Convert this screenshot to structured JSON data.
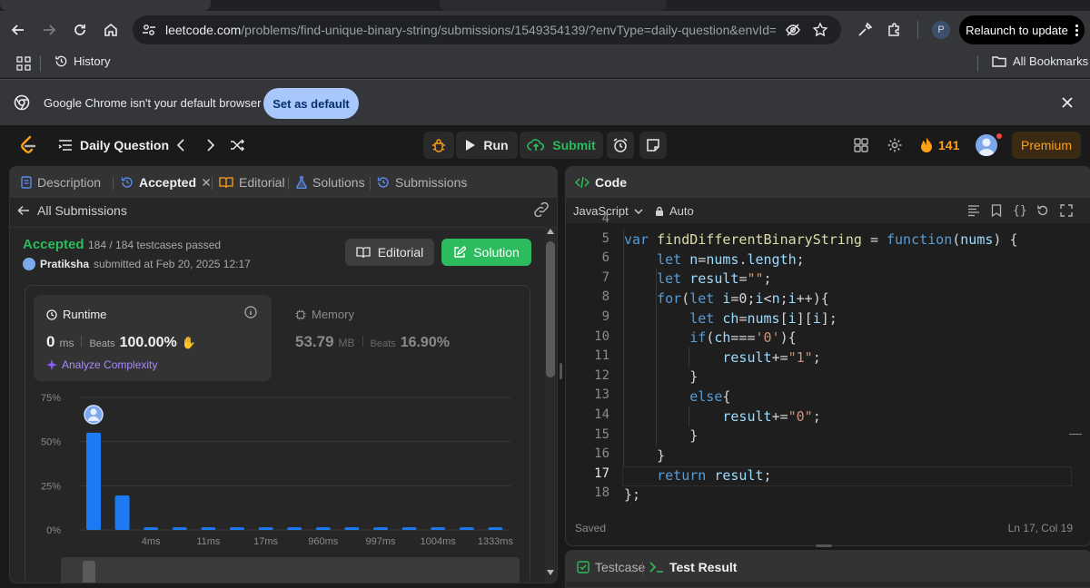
{
  "browser": {
    "url_host": "leetcode.com",
    "url_path": "/problems/find-unique-binary-string/submissions/1549354139/?envType=daily-question&envId=20...",
    "profile_initial": "P",
    "relaunch_label": "Relaunch to update",
    "bookmarks": {
      "history": "History",
      "all_bookmarks": "All Bookmarks"
    },
    "infobar": {
      "message": "Google Chrome isn't your default browser",
      "button": "Set as default"
    }
  },
  "header": {
    "title": "Daily Question",
    "run_label": "Run",
    "submit_label": "Submit",
    "streak": "141",
    "premium_label": "Premium"
  },
  "left_panel": {
    "tabs": [
      {
        "label": "Description"
      },
      {
        "label": "Accepted"
      },
      {
        "label": "Editorial"
      },
      {
        "label": "Solutions"
      },
      {
        "label": "Submissions"
      }
    ],
    "back_label": "All Submissions",
    "status": "Accepted",
    "testcases": "184 / 184 testcases passed",
    "user": "Pratiksha",
    "submitted": "submitted at Feb 20, 2025 12:17",
    "editorial_button": "Editorial",
    "solution_button": "Solution",
    "runtime": {
      "label": "Runtime",
      "value": "0",
      "unit": "ms",
      "beats_label": "Beats",
      "beats_value": "100.00%",
      "analyze": "Analyze Complexity"
    },
    "memory": {
      "label": "Memory",
      "value": "53.79",
      "unit": "MB",
      "beats_label": "Beats",
      "beats_value": "16.90%"
    }
  },
  "chart_data": {
    "type": "bar",
    "y_ticks": [
      "75%",
      "50%",
      "25%",
      "0%"
    ],
    "ylim": [
      0,
      75
    ],
    "x_tick_labels": [
      "4ms",
      "11ms",
      "17ms",
      "960ms",
      "997ms",
      "1004ms",
      "1333ms"
    ],
    "values": [
      55,
      19.5,
      1.5,
      1.5,
      1.5,
      1.5,
      1.5,
      1.5,
      1.5,
      1.5,
      1.5,
      1.5,
      1.5,
      1.5,
      1.5
    ],
    "highlight_index": 0,
    "grid": true
  },
  "editor": {
    "title": "Code",
    "language": "JavaScript",
    "mode": "Auto",
    "line_numbers": [
      "4",
      "5",
      "6",
      "7",
      "8",
      "9",
      "10",
      "11",
      "12",
      "13",
      "14",
      "15",
      "16",
      "17",
      "18"
    ],
    "status_left": "Saved",
    "status_right": "Ln 17, Col 19"
  },
  "bottom_panel": {
    "testcase_label": "Testcase",
    "result_label": "Test Result"
  },
  "colors": {
    "accepted": "#2cbb5d",
    "bar": "#1d7af5",
    "streak": "#ffa116",
    "premium": "#ffa116"
  }
}
